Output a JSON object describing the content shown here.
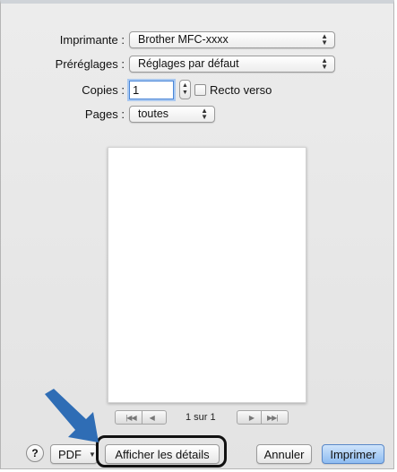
{
  "printer": {
    "label": "Imprimante :",
    "value": "Brother MFC-xxxx"
  },
  "presets": {
    "label": "Préréglages :",
    "value": "Réglages par défaut"
  },
  "copies": {
    "label": "Copies :",
    "value": "1",
    "duplex_label": "Recto verso",
    "duplex_checked": false
  },
  "pages": {
    "label": "Pages :",
    "value": "toutes"
  },
  "preview": {
    "page_indicator": "1 sur 1"
  },
  "footer": {
    "help_label": "?",
    "pdf_label": "PDF",
    "details_label": "Afficher les détails",
    "cancel_label": "Annuler",
    "print_label": "Imprimer"
  },
  "colors": {
    "accent": "#8ebcf1",
    "annotation_arrow": "#2f6db5",
    "focus_ring": "#4a86d8"
  },
  "icons": [
    "up-down-arrows-icon",
    "stepper-icon",
    "first-page-icon",
    "previous-page-icon",
    "next-page-icon",
    "last-page-icon",
    "help-icon",
    "dropdown-arrow-icon",
    "callout-arrow-icon"
  ]
}
